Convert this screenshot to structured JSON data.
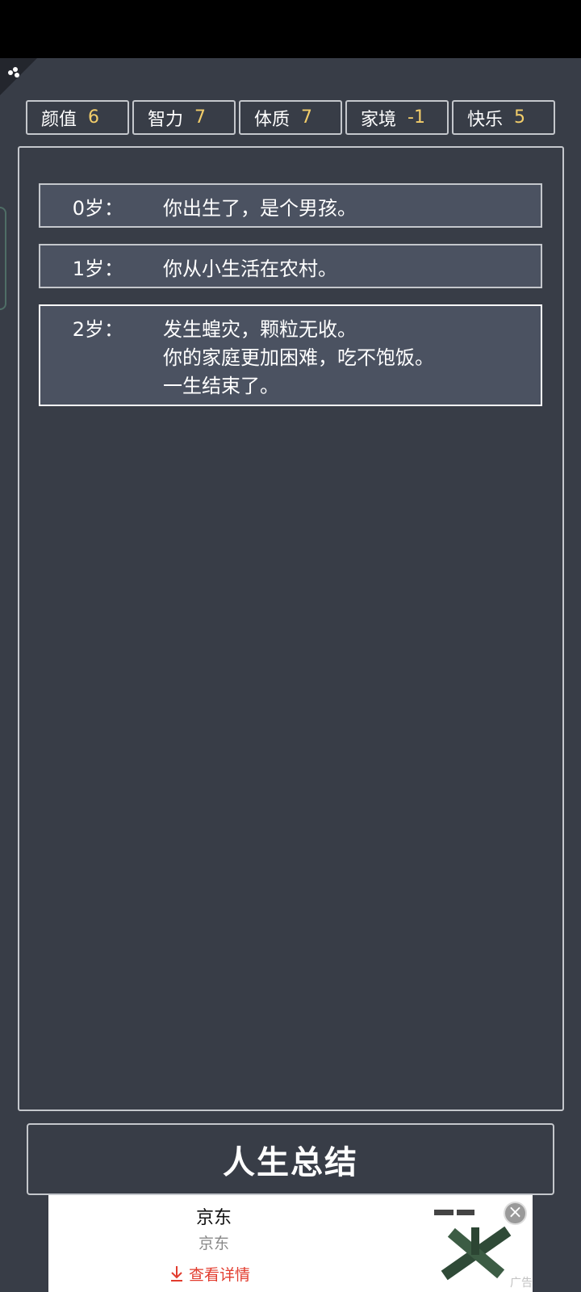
{
  "stats": [
    {
      "name": "颜值",
      "value": "6"
    },
    {
      "name": "智力",
      "value": "7"
    },
    {
      "name": "体质",
      "value": "7"
    },
    {
      "name": "家境",
      "value": "-1"
    },
    {
      "name": "快乐",
      "value": "5"
    }
  ],
  "log": [
    {
      "age": "0岁：",
      "lines": [
        "你出生了，是个男孩。"
      ]
    },
    {
      "age": "1岁：",
      "lines": [
        "你从小生活在农村。"
      ]
    },
    {
      "age": "2岁：",
      "lines": [
        "发生蝗灾，颗粒无收。",
        "你的家庭更加困难，吃不饱饭。",
        "一生结束了。"
      ]
    }
  ],
  "summary_button": "人生总结",
  "ad": {
    "title": "京东",
    "subtitle": "京东",
    "cta": "查看详情",
    "cta_icon": "download-arrow-icon",
    "label": "广告",
    "close_icon": "close-icon"
  },
  "colors": {
    "background": "#383d47",
    "entry_background": "#4b5261",
    "stat_value": "#f2cd6a",
    "border": "#c4c7cc",
    "ad_cta": "#e23c2e"
  }
}
